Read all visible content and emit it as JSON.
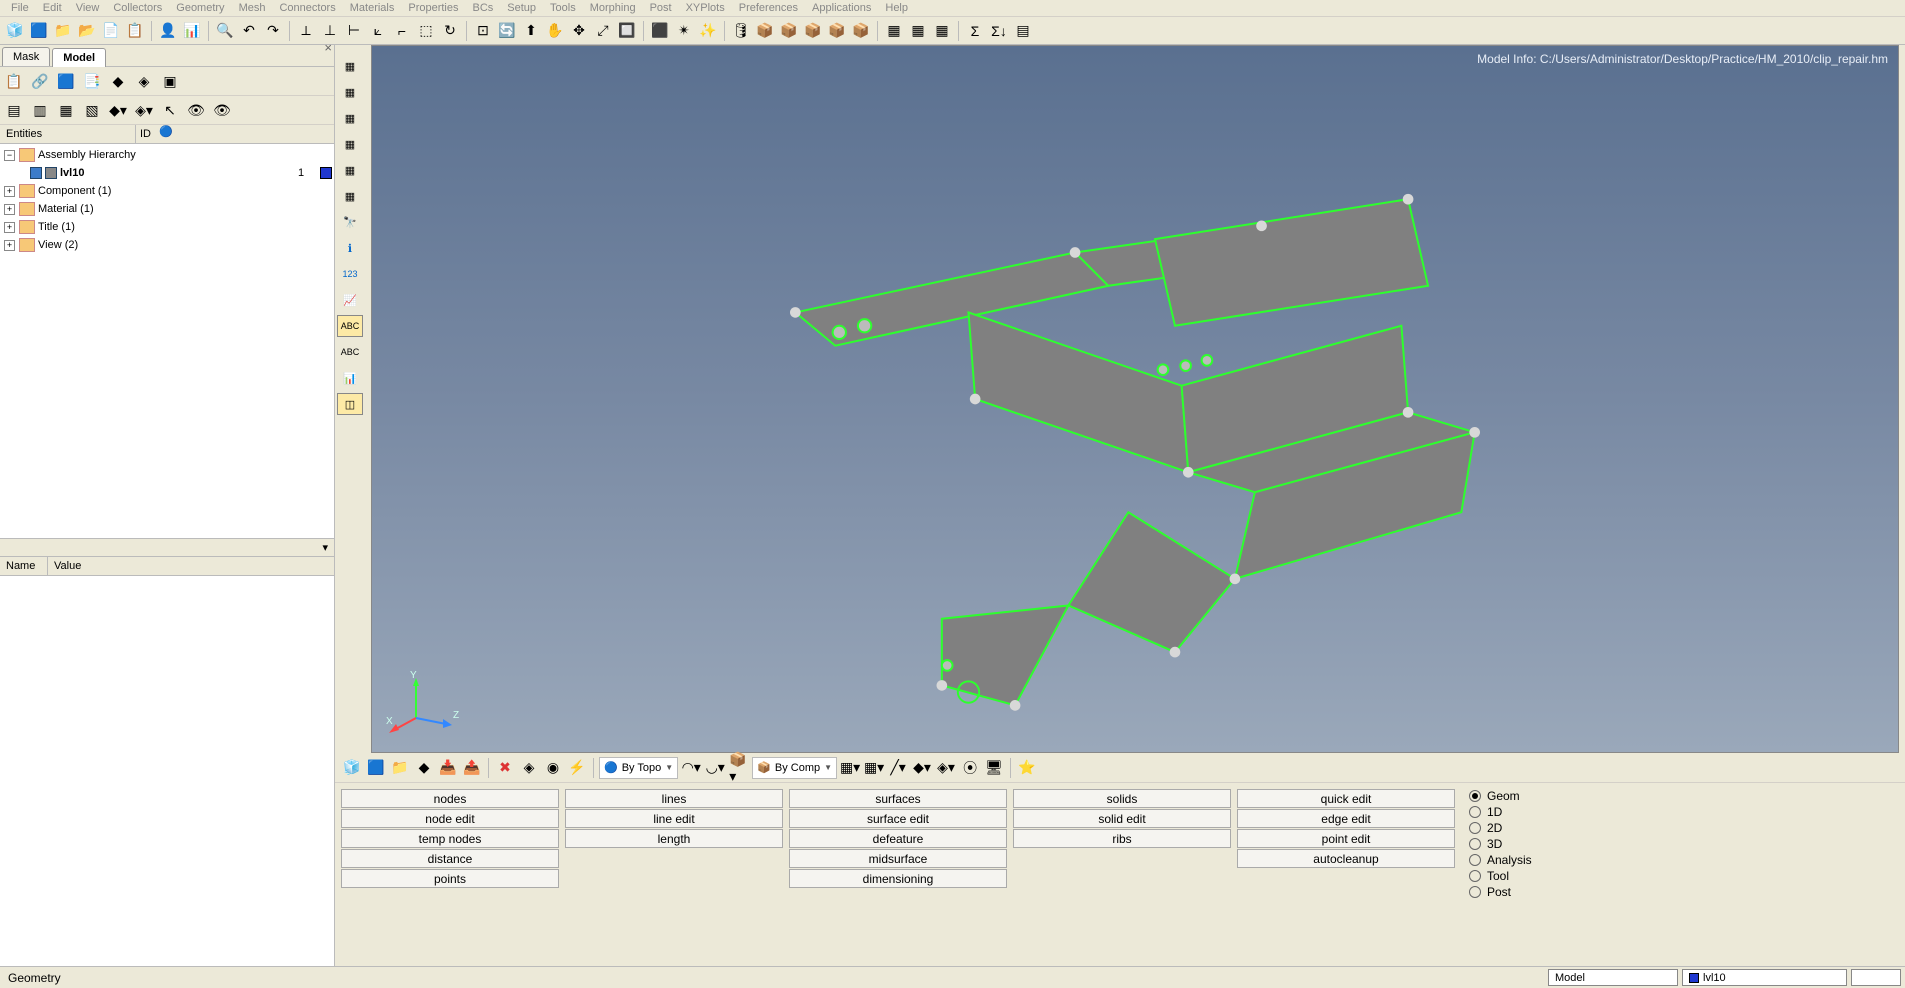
{
  "menubar": [
    "File",
    "Edit",
    "View",
    "Collectors",
    "Geometry",
    "Mesh",
    "Connectors",
    "Materials",
    "Properties",
    "BCs",
    "Setup",
    "Tools",
    "Morphing",
    "Post",
    "XYPlots",
    "Preferences",
    "Applications",
    "Help"
  ],
  "left_panel": {
    "tabs": [
      "Mask",
      "Model"
    ],
    "active_tab": "Model",
    "entities_header": "Entities",
    "id_header": "ID",
    "tree": {
      "root": "Assembly Hierarchy",
      "item_name": "lvl10",
      "item_id": "1",
      "rows": [
        "Component (1)",
        "Material (1)",
        "Title (1)",
        "View (2)"
      ]
    },
    "name_col": "Name",
    "value_col": "Value"
  },
  "viewport": {
    "model_info": "Model Info: C:/Users/Administrator/Desktop/Practice/HM_2010/clip_repair.hm",
    "axes": {
      "x": "X",
      "y": "Y",
      "z": "Z"
    }
  },
  "bottom_toolbar": {
    "combo1": "By Topo",
    "combo2": "By Comp"
  },
  "button_grid": {
    "col1": [
      "nodes",
      "node edit",
      "temp nodes",
      "distance",
      "points"
    ],
    "col2": [
      "lines",
      "line edit",
      "length"
    ],
    "col3": [
      "surfaces",
      "surface edit",
      "defeature",
      "midsurface",
      "dimensioning"
    ],
    "col4": [
      "solids",
      "solid edit",
      "ribs"
    ],
    "col5": [
      "quick edit",
      "edge edit",
      "point edit",
      "autocleanup"
    ]
  },
  "radios": [
    "Geom",
    "1D",
    "2D",
    "3D",
    "Analysis",
    "Tool",
    "Post"
  ],
  "radio_checked": "Geom",
  "statusbar": {
    "left": "Geometry",
    "model_label": "Model",
    "comp": "lvl10"
  }
}
